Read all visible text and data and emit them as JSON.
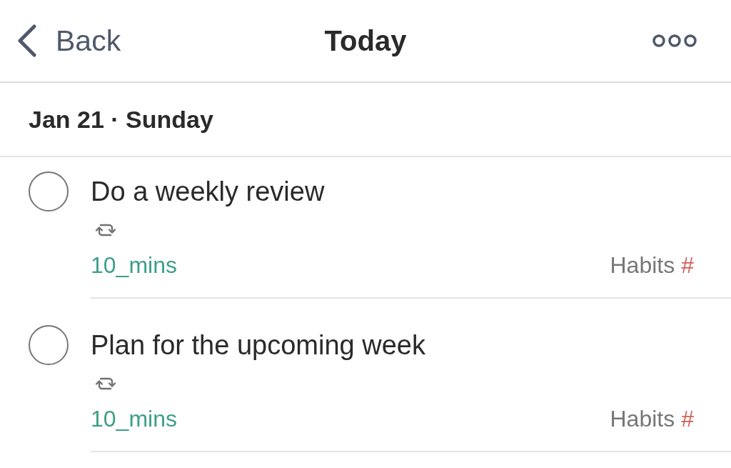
{
  "nav_bar": {
    "back_label": "Back",
    "title": "Today"
  },
  "section": {
    "title": "Jan 21 · Sunday"
  },
  "tasks": [
    {
      "title": "Do a weekly review",
      "completed": false,
      "repeating": true,
      "labels": [
        "10_mins"
      ],
      "project": {
        "name": "Habits",
        "mark": "#",
        "color": "#d2605a"
      }
    },
    {
      "title": "Plan for the upcoming week",
      "completed": false,
      "repeating": true,
      "labels": [
        "10_mins"
      ],
      "project": {
        "name": "Habits",
        "mark": "#",
        "color": "#d2605a"
      }
    }
  ]
}
